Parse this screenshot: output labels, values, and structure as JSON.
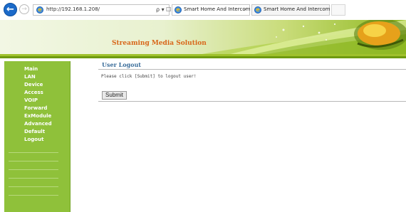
{
  "browser": {
    "back_glyph": "←",
    "forward_glyph": "→",
    "url": "http://192.168.1.208/",
    "address_tools": "ρ ▾ ☐ ↻",
    "tabs": [
      {
        "label": "Smart Home And Intercom ...",
        "close": "×"
      },
      {
        "label": "Smart Home And Intercom Sys..."
      }
    ]
  },
  "banner": {
    "title": "Streaming Media Solution"
  },
  "sidebar": {
    "items": [
      {
        "label": "Main"
      },
      {
        "label": "LAN"
      },
      {
        "label": "Device"
      },
      {
        "label": "Access"
      },
      {
        "label": "VOIP"
      },
      {
        "label": "Forward"
      },
      {
        "label": "ExModule"
      },
      {
        "label": "Advanced"
      },
      {
        "label": "Default"
      },
      {
        "label": "Logout"
      }
    ]
  },
  "content": {
    "title": "User Logout",
    "message": "Please click [Submit] to logout user!",
    "submit_label": "Submit"
  },
  "colors": {
    "sidebar_bg": "#8fc13a",
    "banner_title": "#d8671a",
    "page_title": "#3a6d9a"
  }
}
